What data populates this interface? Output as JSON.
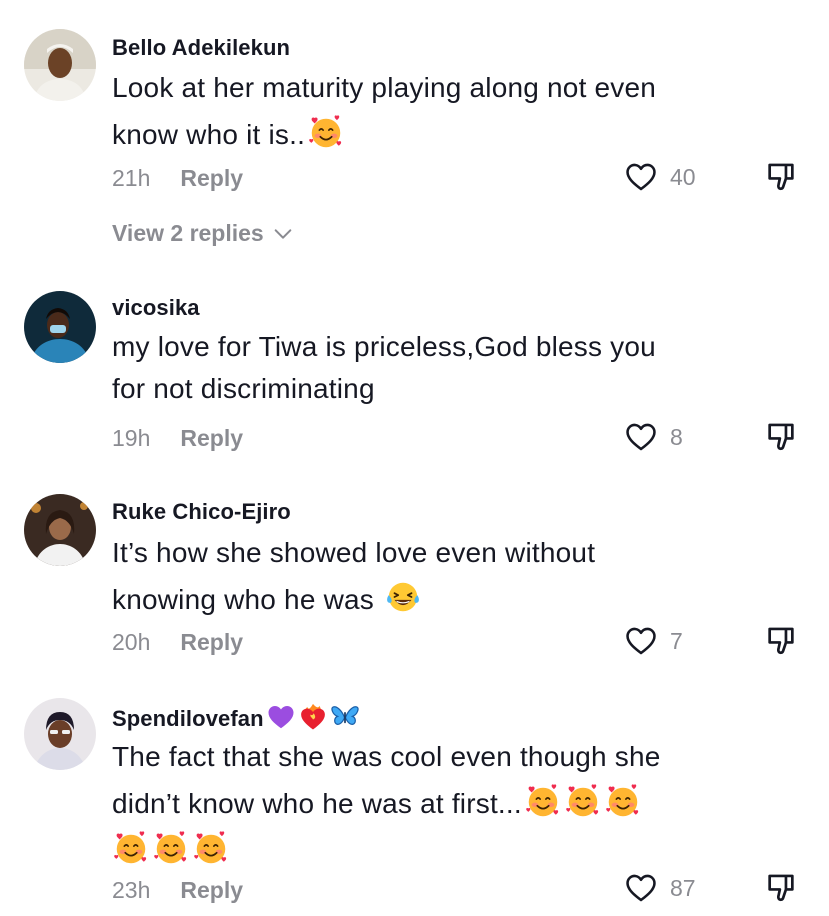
{
  "comments": [
    {
      "username": "Bello Adekilekun",
      "text_lines": [
        "Look at her maturity playing along not even",
        "know who it is.."
      ],
      "time": "21h",
      "reply_label": "Reply",
      "likes": "40",
      "view_replies": "View 2 replies"
    },
    {
      "username": "vicosika",
      "text_lines": [
        "my love for Tiwa is priceless,God bless you",
        "for not discriminating"
      ],
      "time": "19h",
      "reply_label": "Reply",
      "likes": "8"
    },
    {
      "username": "Ruke Chico-Ejiro",
      "text_lines": [
        "It’s how she showed love even without",
        "knowing who he was"
      ],
      "time": "20h",
      "reply_label": "Reply",
      "likes": "7"
    },
    {
      "username": "Spendilovefan",
      "text_lines": [
        "The fact that she was cool even though she",
        "didn’t know who he was at first..."
      ],
      "time": "23h",
      "reply_label": "Reply",
      "likes": "87"
    }
  ],
  "icons": {
    "like": "heart-outline-icon",
    "dislike": "thumbs-down-outline-icon",
    "expand": "chevron-down-icon",
    "emoji_smiling_hearts": "smiling-face-with-hearts-emoji",
    "emoji_laughing": "face-with-tears-of-joy-emoji",
    "badge_purple_heart": "purple-heart-emoji",
    "badge_heart_on_fire": "heart-on-fire-emoji",
    "badge_butterfly": "butterfly-emoji"
  },
  "colors": {
    "username": "#161823",
    "text": "#161823",
    "meta": "#8a8b91",
    "background": "#ffffff"
  }
}
